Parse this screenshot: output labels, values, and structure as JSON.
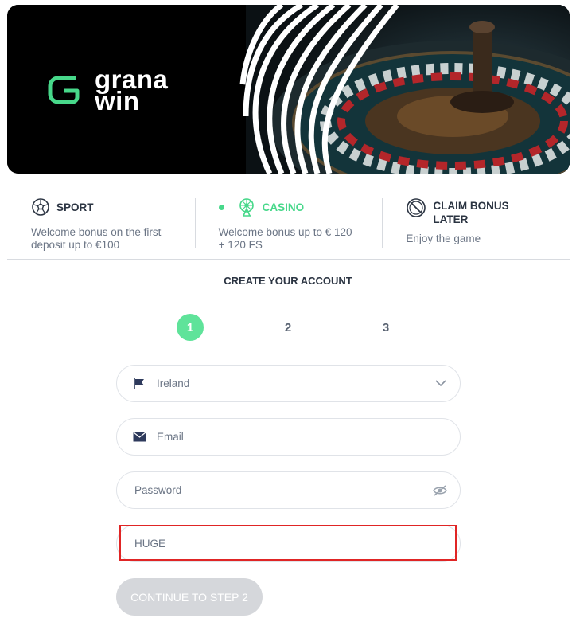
{
  "brand": {
    "logo_line1": "grana",
    "logo_line2": "win",
    "accent": "#47d88a"
  },
  "bonuses": [
    {
      "title": "SPORT",
      "desc": "Welcome bonus on the first deposit up to €100",
      "icon": "football-icon",
      "active": false
    },
    {
      "title": "CASINO",
      "desc": "Welcome bonus up to € 120 + 120 FS",
      "icon": "ferris-wheel-icon",
      "active": true
    },
    {
      "title": "CLAIM BONUS LATER",
      "desc": "Enjoy the game",
      "icon": "no-bonus-icon",
      "active": false
    }
  ],
  "form": {
    "title": "CREATE YOUR ACCOUNT",
    "steps": [
      "1",
      "2",
      "3"
    ],
    "current_step": 1,
    "country": {
      "value": "Ireland",
      "icon": "flag-icon"
    },
    "email": {
      "placeholder": "Email",
      "icon": "envelope-icon"
    },
    "password": {
      "placeholder": "Password",
      "icon": "eye-hidden-icon"
    },
    "promo": {
      "value": "HUGE"
    },
    "continue_label": "CONTINUE TO STEP 2"
  }
}
